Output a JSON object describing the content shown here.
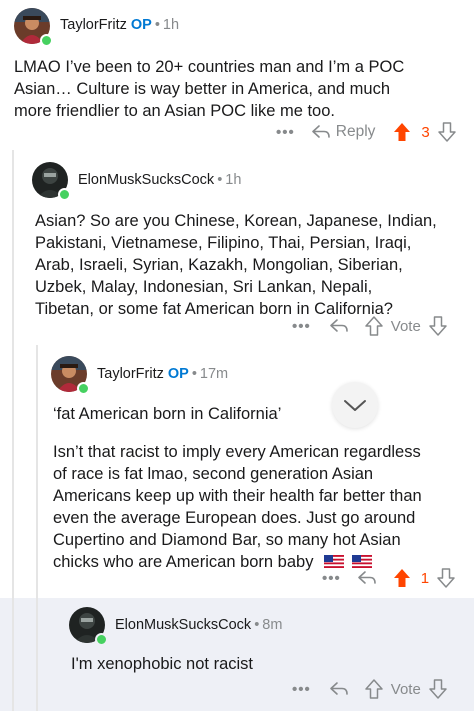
{
  "comments": [
    {
      "username": "TaylorFritz",
      "badge": "OP",
      "separator": "•",
      "time": "1h",
      "lines": [
        "LMAO I’ve been to 20+ countries man and I’m a POC",
        "Asian… Culture is way better in America, and much",
        "more friendlier to an Asian POC like me too."
      ],
      "more": "•••",
      "reply_label": "Reply",
      "votes": "3",
      "upvoted": true
    },
    {
      "username": "ElonMuskSucksCock",
      "separator": "•",
      "time": "1h",
      "lines": [
        "Asian? So are you Chinese, Korean, Japanese, Indian,",
        "Pakistani, Vietnamese, Filipino, Thai, Persian, Iraqi,",
        "Arab, Israeli, Syrian, Kazakh, Mongolian, Siberian,",
        "Uzbek, Malay, Indonesian, Sri Lankan, Nepali,",
        "Tibetan, or some fat American born in California?"
      ],
      "more": "•••",
      "vote_label": "Vote"
    },
    {
      "username": "TaylorFritz",
      "badge": "OP",
      "separator": "•",
      "time": "17m",
      "quote": "‘fat American born in California’",
      "lines": [
        "Isn’t that racist to imply every American regardless",
        "of race is fat lmao, second generation Asian",
        "Americans keep up with their health far better than",
        "even the average European does. Just go around",
        "Cupertino and Diamond Bar, so many hot Asian",
        "chicks who are American born baby"
      ],
      "more": "•••",
      "votes": "1",
      "upvoted": true
    },
    {
      "username": "ElonMuskSucksCock",
      "separator": "•",
      "time": "8m",
      "lines": [
        "I'm xenophobic not racist"
      ],
      "more": "•••",
      "vote_label": "Vote"
    }
  ],
  "colors": {
    "upvote_active": "#ff4500",
    "op_badge": "#0079d3",
    "meta_gray": "#878a8c",
    "online_dot": "#46d160",
    "highlight_bg": "#eef0f6"
  },
  "icons": [
    "more-options-icon",
    "reply-arrow-icon",
    "upvote-icon",
    "downvote-icon",
    "collapse-chevron-icon",
    "us-flag-icon"
  ]
}
